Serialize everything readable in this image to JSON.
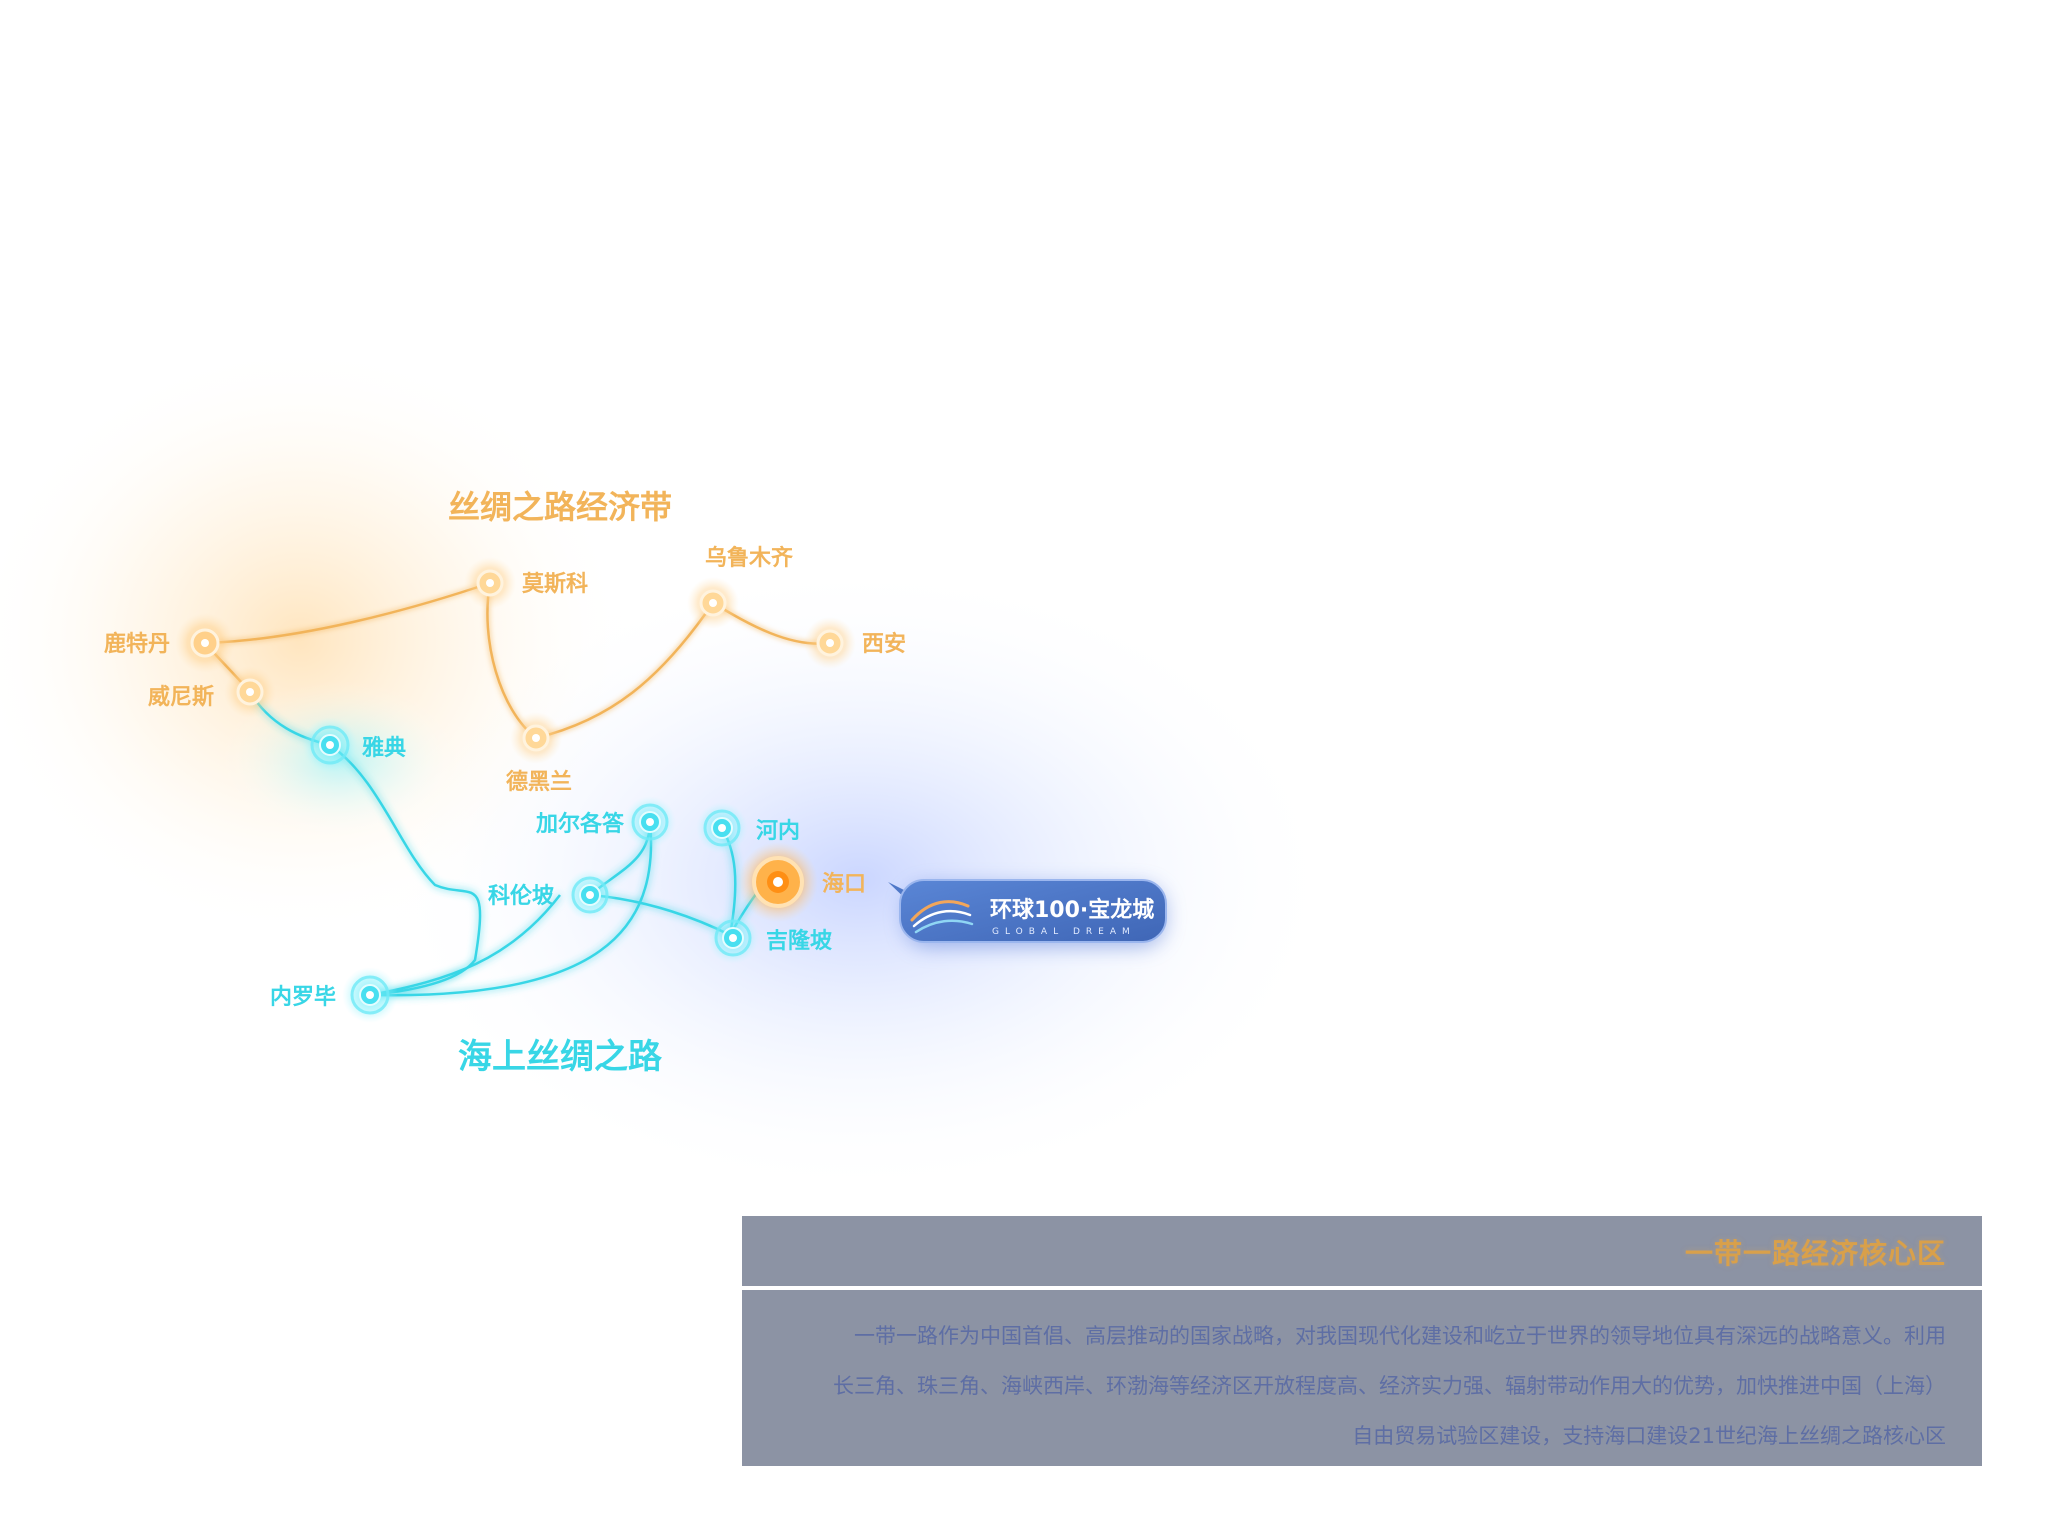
{
  "map": {
    "belt_title": "丝绸之路经济带",
    "road_title": "海上丝绸之路",
    "cities": {
      "rotterdam": "鹿特丹",
      "venice": "威尼斯",
      "moscow": "莫斯科",
      "urumqi": "乌鲁木齐",
      "xian": "西安",
      "tehran": "德黑兰",
      "athens": "雅典",
      "kolkata": "加尔各答",
      "hanoi": "河内",
      "haikou": "海口",
      "colombo": "科伦坡",
      "kualalumpur": "吉隆坡",
      "nairobi": "内罗毕"
    },
    "colors": {
      "belt": "#f2b45a",
      "road": "#38d6e6",
      "haikou": "#f59a2c",
      "logo_bg": "#4f78c8"
    }
  },
  "logo": {
    "name": "环球100·宝龙城",
    "subtitle": "GLOBAL DREAM"
  },
  "info": {
    "title": "一带一路经济核心区",
    "line1": "一带一路作为中国首倡、高层推动的国家战略，对我国现代化建设和屹立于世界的领导地位具有深远的战略意义。利用",
    "line2": "长三角、珠三角、海峡西岸、环渤海等经济区开放程度高、经济实力强、辐射带动作用大的优势，加快推进中国（上海）",
    "line3": "自由贸易试验区建设，支持海口建设21世纪海上丝绸之路核心区"
  }
}
